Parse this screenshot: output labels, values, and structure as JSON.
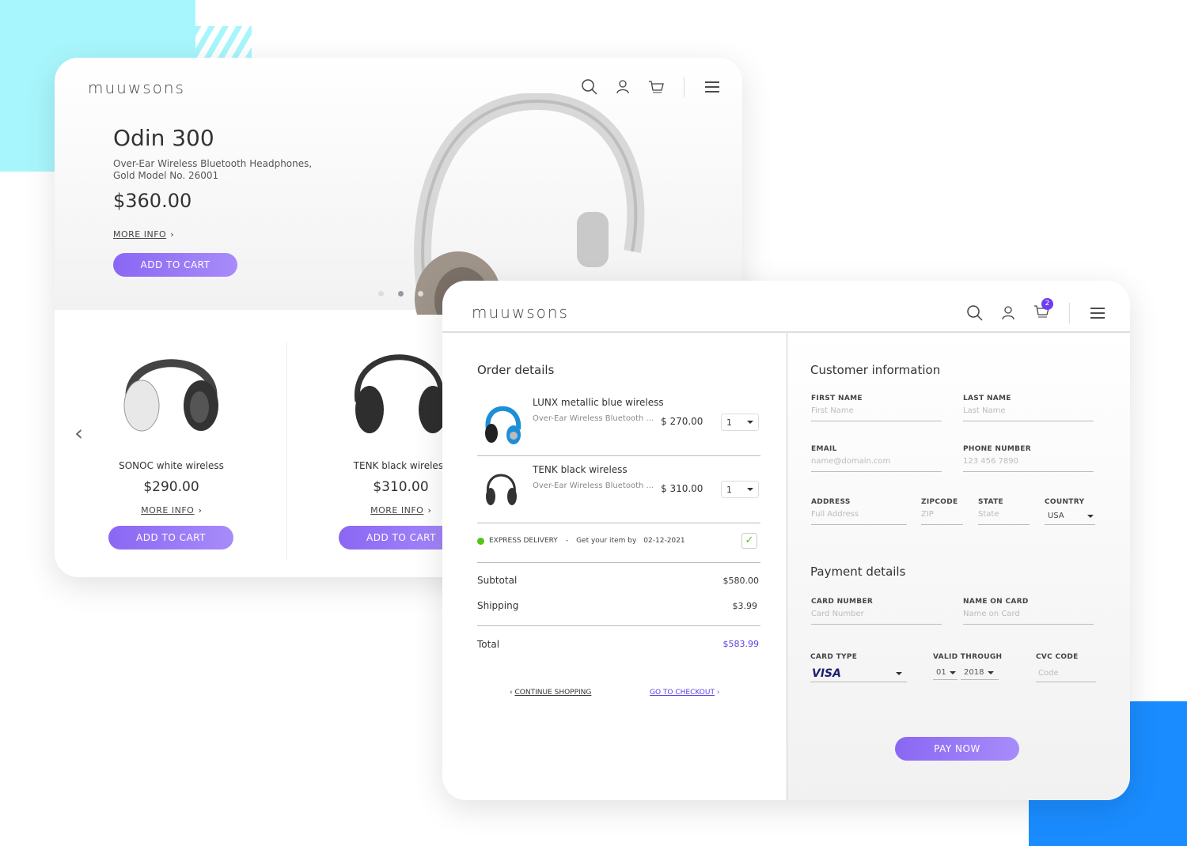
{
  "brand": "muuwsons",
  "product_page": {
    "hero": {
      "title": "Odin 300",
      "description_line1": "Over-Ear Wireless Bluetooth Headphones,",
      "description_line2": "Gold Model No. 26001",
      "price": "$360.00",
      "more_info": "MORE INFO",
      "add_to_cart": "ADD TO CART",
      "carousel_dots": 3,
      "active_dot": 2
    },
    "products": [
      {
        "name": "SONOC white wireless",
        "price": "$290.00",
        "more_info": "MORE INFO",
        "add_to_cart": "ADD TO CART"
      },
      {
        "name": "TENK black wireless",
        "price": "$310.00",
        "more_info": "MORE INFO",
        "add_to_cart": "ADD TO CART"
      }
    ]
  },
  "checkout": {
    "cart_count": "2",
    "order": {
      "title": "Order details",
      "items": [
        {
          "name": "LUNX metallic blue wireless",
          "desc": "Over-Ear Wireless Bluetooth ...",
          "price": "$ 270.00",
          "qty": "1"
        },
        {
          "name": "TENK black wireless",
          "desc": "Over-Ear Wireless Bluetooth ...",
          "price": "$ 310.00",
          "qty": "1"
        }
      ],
      "delivery": {
        "label": "EXPRESS DELIVERY",
        "sep": "-",
        "text": "Get your item by",
        "date": "02-12-2021",
        "checked": true
      },
      "subtotal_label": "Subtotal",
      "subtotal": "$580.00",
      "shipping_label": "Shipping",
      "shipping": "$3.99",
      "total_label": "Total",
      "total": "$583.99",
      "continue": "CONTINUE SHOPPING",
      "checkout": "GO TO CHECKOUT"
    },
    "customer": {
      "title": "Customer information",
      "first_name": {
        "label": "FIRST NAME",
        "placeholder": "First Name"
      },
      "last_name": {
        "label": "LAST NAME",
        "placeholder": "Last Name"
      },
      "email": {
        "label": "EMAIL",
        "placeholder": "name@domain.com"
      },
      "phone": {
        "label": "PHONE NUMBER",
        "placeholder": "123 456 7890"
      },
      "address": {
        "label": "ADDRESS",
        "placeholder": "Full Address"
      },
      "zip": {
        "label": "ZIPCODE",
        "placeholder": "ZIP"
      },
      "state": {
        "label": "STATE",
        "placeholder": "State"
      },
      "country": {
        "label": "COUNTRY",
        "value": "USA"
      }
    },
    "payment": {
      "title": "Payment details",
      "card_number": {
        "label": "CARD NUMBER",
        "placeholder": "Card Number"
      },
      "name_on_card": {
        "label": "NAME ON CARD",
        "placeholder": "Name on Card"
      },
      "card_type": {
        "label": "CARD TYPE",
        "value": "VISA"
      },
      "valid": {
        "label": "VALID THROUGH",
        "month": "01",
        "year": "2018"
      },
      "cvc": {
        "label": "CVC CODE",
        "placeholder": "Code"
      },
      "pay": "PAY NOW"
    }
  },
  "colors": {
    "accent": "#8a67f3",
    "link": "#5a3de6",
    "green": "#52c41a",
    "cyan": "#a8f6fd",
    "blue": "#1a8cff"
  }
}
